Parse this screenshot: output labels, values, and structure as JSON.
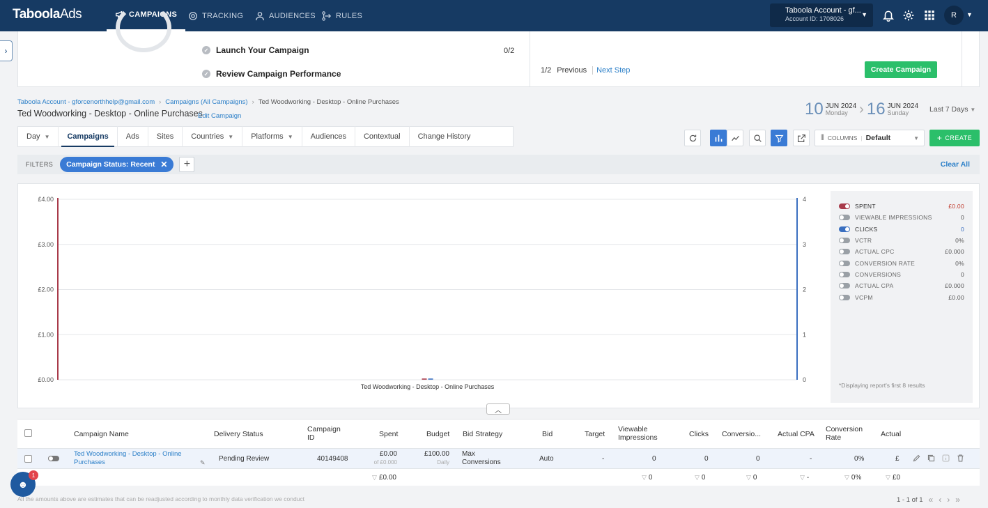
{
  "nav": {
    "logo_main": "Taboola",
    "logo_ads": "Ads",
    "items": [
      {
        "label": "CAMPAIGNS",
        "icon": "megaphone-icon"
      },
      {
        "label": "TRACKING",
        "icon": "target-icon"
      },
      {
        "label": "AUDIENCES",
        "icon": "person-icon"
      },
      {
        "label": "RULES",
        "icon": "flow-icon"
      }
    ],
    "account_name": "Taboola Account - gf...",
    "account_id": "Account ID: 1708026",
    "avatar_initial": "R"
  },
  "setup": {
    "steps": [
      "Launch Your Campaign",
      "Review Campaign Performance"
    ],
    "step_count": "0/2",
    "pager_current": "1/2",
    "pager_previous": "Previous",
    "pager_next": "Next Step",
    "create_campaign_label": "Create Campaign"
  },
  "breadcrumb": {
    "items": [
      "Taboola Account - gforcenorthhelp@gmail.com",
      "Campaigns (All Campaigns)",
      "Ted Woodworking - Desktop - Online Purchases"
    ],
    "title": "Ted Woodworking -  Desktop - Online Purchases",
    "edit_link": "Edit Campaign"
  },
  "date_range": {
    "start_day": "10",
    "start_month": "JUN 2024",
    "start_weekday": "Monday",
    "end_day": "16",
    "end_month": "JUN 2024",
    "end_weekday": "Sunday",
    "preset": "Last 7 Days"
  },
  "tabs": [
    {
      "label": "Day",
      "dropdown": true
    },
    {
      "label": "Campaigns",
      "dropdown": false
    },
    {
      "label": "Ads",
      "dropdown": false
    },
    {
      "label": "Sites",
      "dropdown": false
    },
    {
      "label": "Countries",
      "dropdown": true
    },
    {
      "label": "Platforms",
      "dropdown": true
    },
    {
      "label": "Audiences",
      "dropdown": false
    },
    {
      "label": "Contextual",
      "dropdown": false
    },
    {
      "label": "Change History",
      "dropdown": false
    }
  ],
  "toolbar": {
    "columns_label": "COLUMNS",
    "columns_value": "Default",
    "create_label": "CREATE"
  },
  "filters": {
    "label": "FILTERS",
    "chip": "Campaign Status: Recent",
    "clear_all": "Clear All"
  },
  "chart_data": {
    "type": "bar",
    "categories": [
      "Ted Woodworking -  Desktop - Online Purchases"
    ],
    "series": [
      {
        "name": "SPENT",
        "values": [
          0
        ],
        "color": "#a83a4a"
      },
      {
        "name": "CLICKS",
        "values": [
          0
        ],
        "color": "#3a6fc0"
      }
    ],
    "y_left_ticks": [
      "£0.00",
      "£1.00",
      "£2.00",
      "£3.00",
      "£4.00"
    ],
    "y_left_values": [
      0,
      1,
      2,
      3,
      4
    ],
    "ylim_left": [
      0,
      4
    ],
    "y_right_ticks": [
      "0",
      "1",
      "2",
      "3",
      "4"
    ],
    "y_right_values": [
      0,
      1,
      2,
      3,
      4
    ],
    "ylim_right": [
      0,
      4
    ],
    "grid": true
  },
  "legend": {
    "items": [
      {
        "name": "SPENT",
        "value": "£0.00",
        "on": true,
        "color": "#a83a4a"
      },
      {
        "name": "VIEWABLE IMPRESSIONS",
        "value": "0",
        "on": false,
        "color": "#9aa0a6"
      },
      {
        "name": "CLICKS",
        "value": "0",
        "on": true,
        "color": "#3a6fc0"
      },
      {
        "name": "VCTR",
        "value": "0%",
        "on": false,
        "color": "#9aa0a6"
      },
      {
        "name": "ACTUAL CPC",
        "value": "£0.000",
        "on": false,
        "color": "#9aa0a6"
      },
      {
        "name": "CONVERSION RATE",
        "value": "0%",
        "on": false,
        "color": "#9aa0a6"
      },
      {
        "name": "CONVERSIONS",
        "value": "0",
        "on": false,
        "color": "#9aa0a6"
      },
      {
        "name": "ACTUAL CPA",
        "value": "£0.000",
        "on": false,
        "color": "#9aa0a6"
      },
      {
        "name": "VCPM",
        "value": "£0.00",
        "on": false,
        "color": "#9aa0a6"
      }
    ],
    "note": "*Displaying report's first 8 results"
  },
  "table": {
    "headers": [
      "Campaign Name",
      "Delivery Status",
      "Campaign ID",
      "Spent",
      "Budget",
      "Bid Strategy",
      "Bid",
      "Target",
      "Viewable Impressions",
      "Clicks",
      "Conversio...",
      "Actual CPA",
      "Conversion Rate",
      "Actual"
    ],
    "row": {
      "name": "Ted Woodworking -  Desktop - Online Purchases",
      "status": "Pending Review",
      "id": "40149408",
      "spent": "£0.00",
      "spent_sub": "of £0.000",
      "budget": "£100.00",
      "budget_sub": "Daily",
      "bid_strategy": "Max Conversions",
      "bid": "Auto",
      "target": "-",
      "viewable": "0",
      "clicks": "0",
      "conversions": "0",
      "cpa": "-",
      "conv_rate": "0%",
      "actual": "£"
    },
    "totals": {
      "spent": "£0.00",
      "viewable": "0",
      "clicks": "0",
      "conversions": "0",
      "cpa": "-",
      "conv_rate": "0%",
      "actual": "£0"
    }
  },
  "footer": {
    "note": "All the amounts above are estimates that can be readjusted according to monthly data verification we conduct",
    "pagination": "1 - 1 of 1",
    "chat_badge": "1"
  }
}
